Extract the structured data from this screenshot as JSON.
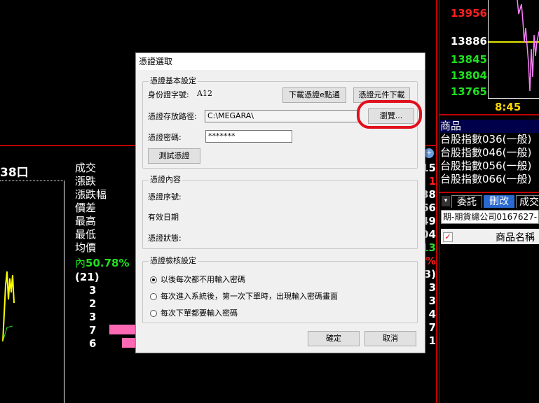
{
  "background": {
    "prices": [
      {
        "value": "13956",
        "color": "#ff2020"
      },
      {
        "value": "13886",
        "color": "#ffffff"
      },
      {
        "value": "13845",
        "color": "#20e020"
      },
      {
        "value": "13804",
        "color": "#20e020"
      },
      {
        "value": "13765",
        "color": "#20e020"
      }
    ],
    "time": "8:45",
    "products_header": "商品",
    "products": [
      "台股指數036(一般)",
      "台股指數046(一般)",
      "台股指數056(一般)",
      "台股指數066(一般)"
    ],
    "tabs": [
      "委託",
      "刪改",
      "成交"
    ],
    "account": "期-期貨總公司0167627-",
    "col_header": "商品名稱",
    "left_title": "38口",
    "quote_labels": [
      "成交",
      "漲跌",
      "漲跌幅",
      "價差",
      "最高",
      "最低",
      "均價"
    ],
    "inner_label": "內",
    "inner_pct": "50.78%",
    "count": "(21)",
    "depth": [
      "3",
      "2",
      "3",
      "7",
      "6"
    ],
    "edge_values": [
      "15",
      "1",
      "38",
      "66",
      "49",
      "04",
      "13",
      "%",
      "3)",
      "3",
      "3",
      "4",
      "7",
      "1"
    ]
  },
  "dialog": {
    "title": "憑證選取",
    "basic": {
      "legend": "憑證基本設定",
      "id_label": "身份證字號:",
      "id_value": "A12",
      "download_emoney_btn": "下載憑證e點通",
      "download_component_btn": "憑證元件下載",
      "path_label": "憑證存放路徑:",
      "path_value": "C:\\MEGARA\\",
      "browse_btn": "瀏覽...",
      "password_label": "憑證密碼:",
      "password_value": "*******",
      "test_btn": "測試憑證"
    },
    "content": {
      "legend": "憑證內容",
      "serial_label": "憑證序號:",
      "expiry_label": "有效日期",
      "status_label": "憑證狀態:"
    },
    "verify": {
      "legend": "憑證檢核設定",
      "options": [
        "以後每次都不用輸入密碼",
        "每次進入系統後，第一次下單時，出現輸入密碼畫面",
        "每次下單都要輸入密碼"
      ],
      "selected": 0
    },
    "ok_btn": "確定",
    "cancel_btn": "取消"
  },
  "colors": {
    "highlight_ring": "#e0101c",
    "grid_red": "#c00000",
    "price_red": "#ff2020",
    "price_green": "#20e020",
    "bar_pink": "#ff69b4"
  }
}
